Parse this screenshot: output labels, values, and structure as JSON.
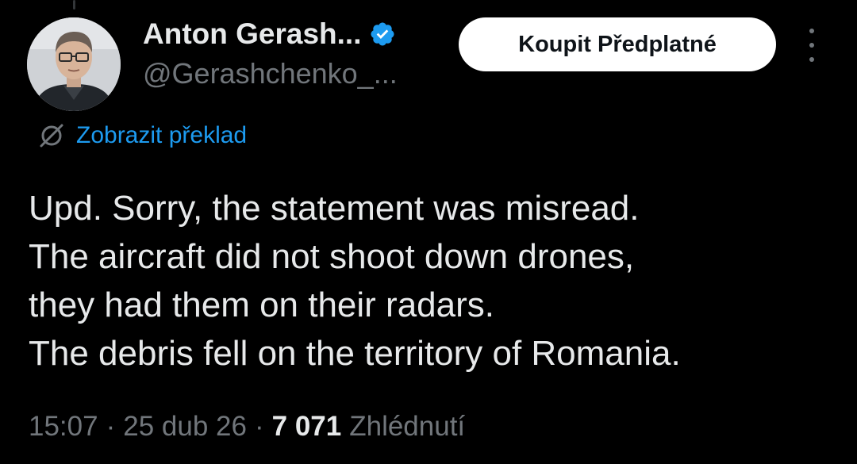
{
  "author": {
    "display_name": "Anton Gerash...",
    "handle": "@Gerashchenko_...",
    "verified": true,
    "verified_color": "#1d9bf0"
  },
  "header": {
    "subscribe_label": "Koupit Předplatné"
  },
  "translate": {
    "label": "Zobrazit překlad",
    "icon": "globe-slash-icon"
  },
  "tweet": {
    "lines": [
      "Upd. Sorry, the statement was misread.",
      "The aircraft did not shoot down drones,",
      "they had them on their radars.",
      "The debris fell on the territory of Romania."
    ]
  },
  "meta": {
    "time": "15:07",
    "separator": "·",
    "date": "25 dub 26",
    "views_count": "7 071",
    "views_label": "Zhlédnutí"
  },
  "colors": {
    "background": "#000000",
    "text_primary": "#e7e9ea",
    "text_secondary": "#71767b",
    "accent": "#1d9bf0",
    "button_bg": "#ffffff",
    "button_text": "#0f1419"
  }
}
